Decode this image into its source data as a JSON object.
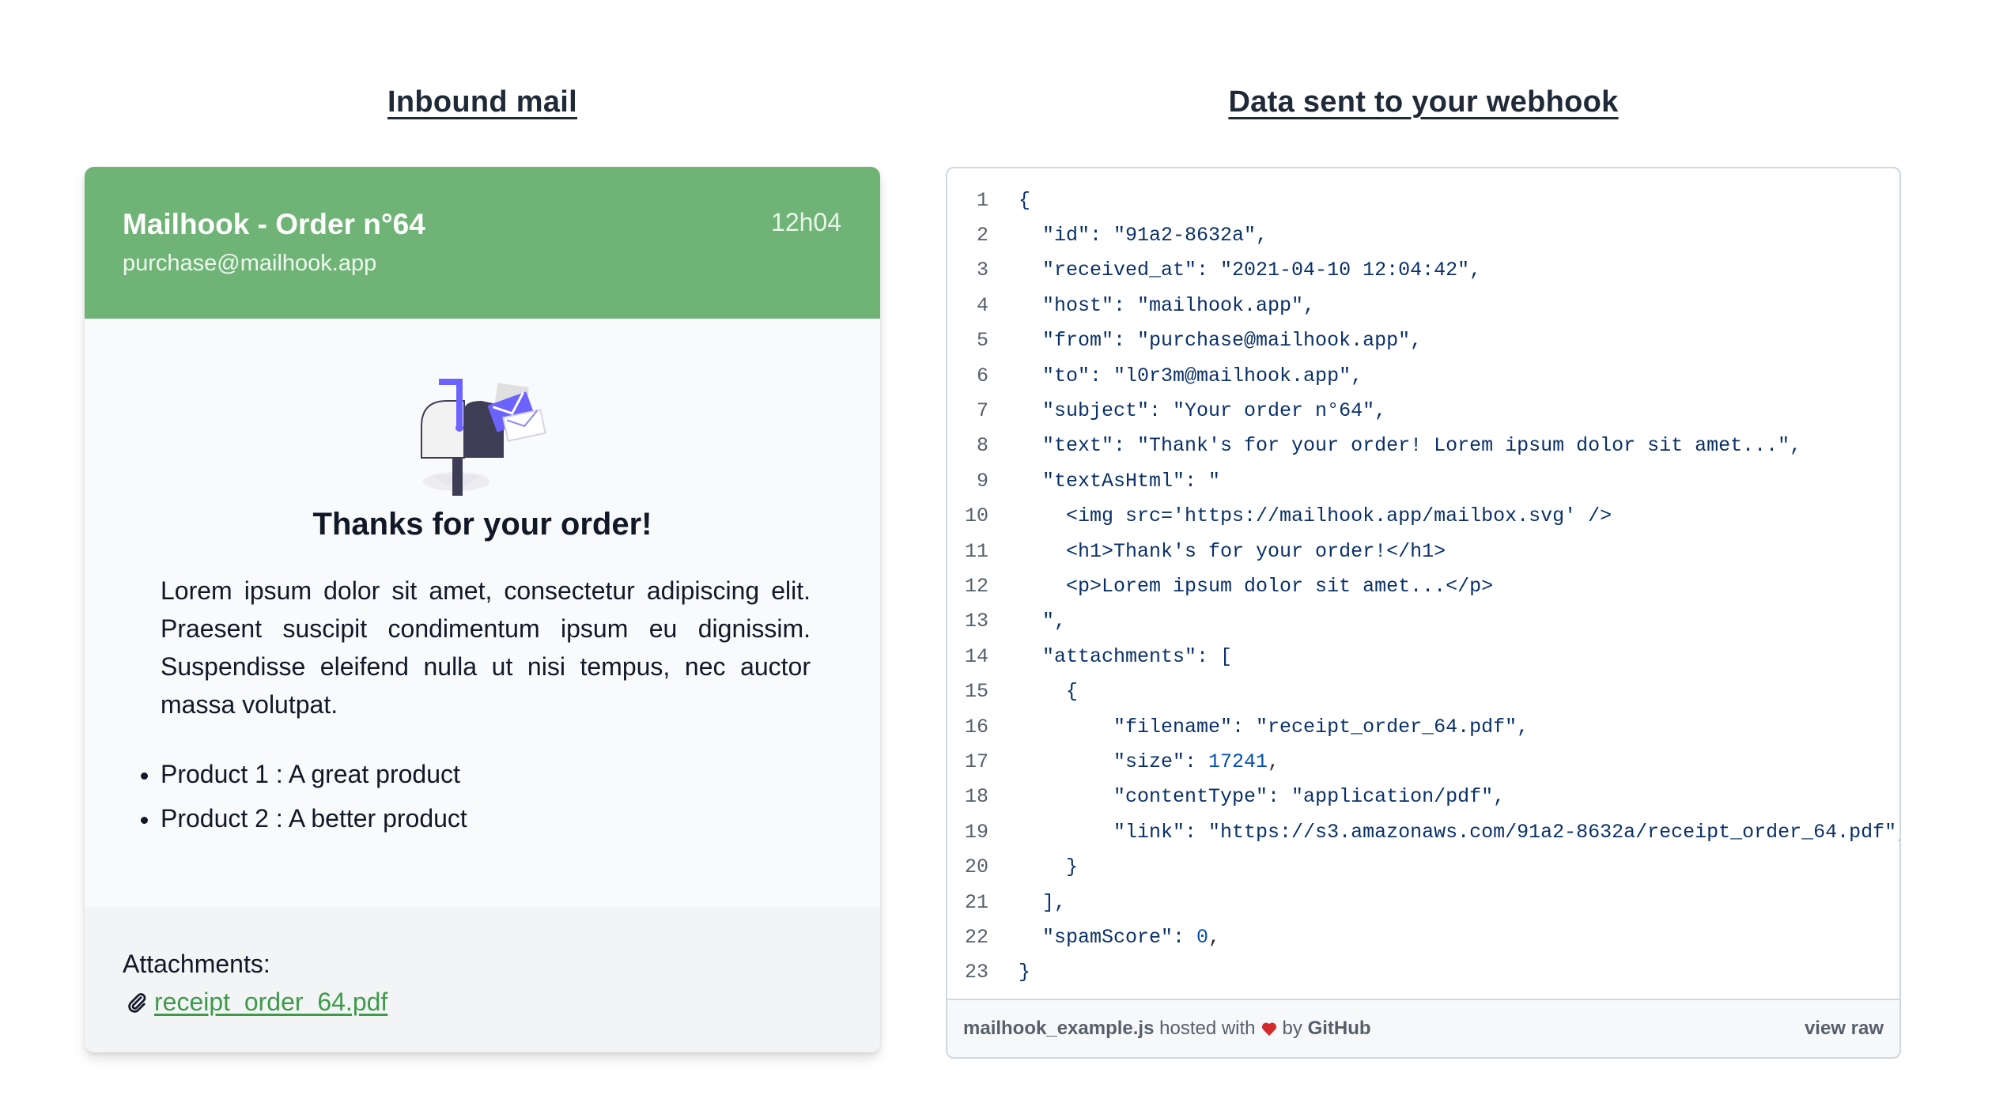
{
  "headings": {
    "left": "Inbound mail",
    "right": "Data sent to your webhook"
  },
  "mail": {
    "subject": "Mailhook - Order n°64",
    "from": "purchase@mailhook.app",
    "time": "12h04",
    "title": "Thanks for your order!",
    "paragraph": "Lorem ipsum dolor sit amet, consectetur adipiscing elit. Praesent suscipit condimentum ipsum eu dignissim. Suspendisse eleifend nulla ut nisi tempus, nec auctor massa volutpat.",
    "products": [
      "Product 1 : A great product",
      "Product 2 : A better product"
    ],
    "attachments_label": "Attachments:",
    "attachment_file": "receipt_order_64.pdf",
    "header_color": "#6fb476",
    "link_color": "#3d9a4a"
  },
  "gist": {
    "lines": [
      {
        "n": "1",
        "text": "{"
      },
      {
        "n": "2",
        "text": "  \"id\": \"91a2-8632a\","
      },
      {
        "n": "3",
        "text": "  \"received_at\": \"2021-04-10 12:04:42\","
      },
      {
        "n": "4",
        "text": "  \"host\": \"mailhook.app\","
      },
      {
        "n": "5",
        "text": "  \"from\": \"purchase@mailhook.app\","
      },
      {
        "n": "6",
        "text": "  \"to\": \"l0r3m@mailhook.app\","
      },
      {
        "n": "7",
        "text": "  \"subject\": \"Your order n°64\","
      },
      {
        "n": "8",
        "text": "  \"text\": \"Thank's for your order! Lorem ipsum dolor sit amet...\","
      },
      {
        "n": "9",
        "text": "  \"textAsHtml\": \""
      },
      {
        "n": "10",
        "text": "    <img src='https://mailhook.app/mailbox.svg' />"
      },
      {
        "n": "11",
        "text": "    <h1>Thank's for your order!</h1>"
      },
      {
        "n": "12",
        "text": "    <p>Lorem ipsum dolor sit amet...</p>"
      },
      {
        "n": "13",
        "text": "  \","
      },
      {
        "n": "14",
        "text": "  \"attachments\": ["
      },
      {
        "n": "15",
        "text": "    {"
      },
      {
        "n": "16",
        "text": "        \"filename\": \"receipt_order_64.pdf\","
      },
      {
        "n": "17",
        "text": "        \"size\": 17241,"
      },
      {
        "n": "18",
        "text": "        \"contentType\": \"application/pdf\","
      },
      {
        "n": "19",
        "text": "        \"link\": \"https://s3.amazonaws.com/91a2-8632a/receipt_order_64.pdf\","
      },
      {
        "n": "20",
        "text": "    }"
      },
      {
        "n": "21",
        "text": "  ],"
      },
      {
        "n": "22",
        "text": "  \"spamScore\": 0,"
      },
      {
        "n": "23",
        "text": "}"
      }
    ],
    "footer": {
      "filename": "mailhook_example.js",
      "hosted_with": "hosted with",
      "by": "by",
      "github": "GitHub",
      "view_raw": "view raw"
    }
  }
}
